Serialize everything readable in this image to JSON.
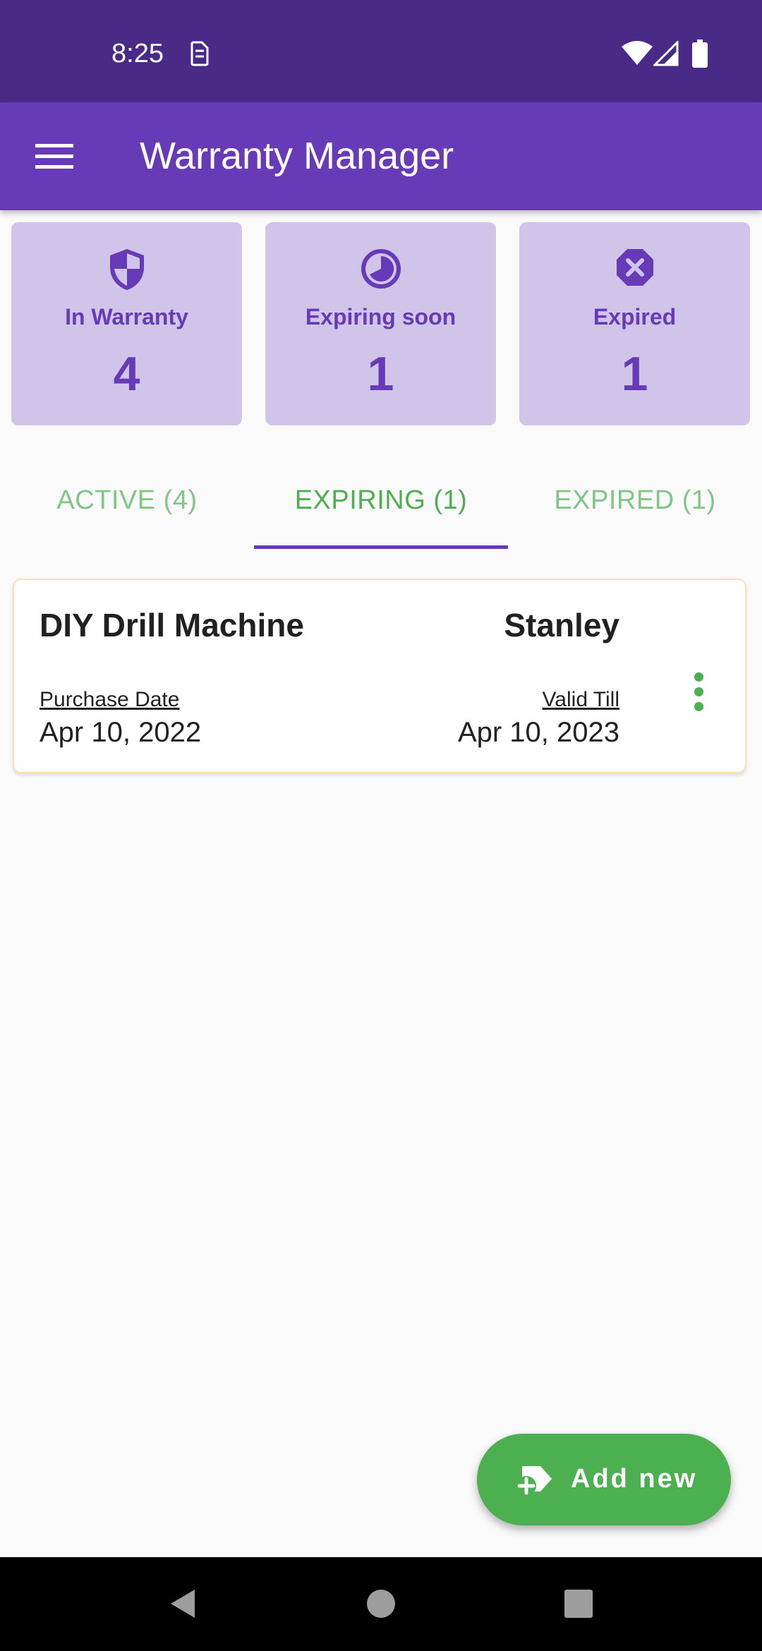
{
  "status_bar": {
    "time": "8:25",
    "icons": [
      "sim-card-icon",
      "wifi-icon",
      "cell-signal-icon",
      "battery-icon"
    ]
  },
  "app_bar": {
    "title": "Warranty Manager",
    "menu_icon": "hamburger-menu-icon"
  },
  "summary": [
    {
      "label": "In Warranty",
      "count": "4",
      "icon": "shield-icon"
    },
    {
      "label": "Expiring soon",
      "count": "1",
      "icon": "clock-pie-icon"
    },
    {
      "label": "Expired",
      "count": "1",
      "icon": "close-octagon-icon"
    }
  ],
  "tabs": [
    {
      "label": "ACTIVE (4)",
      "selected": false
    },
    {
      "label": "EXPIRING (1)",
      "selected": true
    },
    {
      "label": "EXPIRED (1)",
      "selected": false
    }
  ],
  "warranty_items": [
    {
      "product": "DIY Drill Machine",
      "brand": "Stanley",
      "purchase_label": "Purchase Date",
      "purchase_date": "Apr 10, 2022",
      "valid_label": "Valid Till",
      "valid_date": "Apr 10, 2023"
    }
  ],
  "fab": {
    "label": "Add new",
    "icon": "add-tag-icon"
  },
  "nav": {
    "icons": [
      "back-icon",
      "home-icon",
      "recents-icon"
    ]
  },
  "colors": {
    "status_bar": "#4a2a87",
    "primary": "#673ab7",
    "card_bg": "#d1c4e9",
    "accent_green": "#4caf50",
    "tab_inactive": "#81c784"
  }
}
